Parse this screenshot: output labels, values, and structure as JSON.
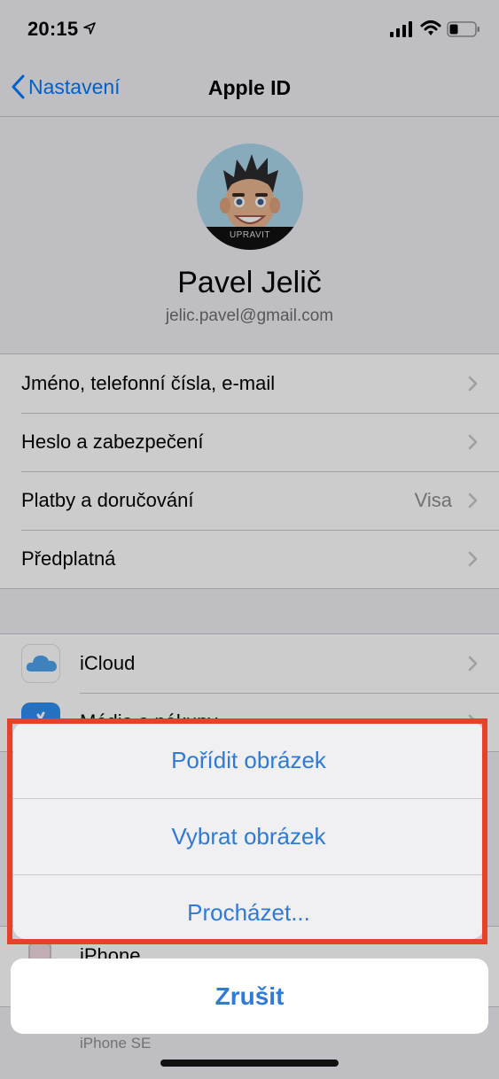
{
  "status_bar": {
    "time": "20:15"
  },
  "nav": {
    "back_label": "Nastavení",
    "title": "Apple ID"
  },
  "profile": {
    "edit_label": "UPRAVIT",
    "name": "Pavel Jelič",
    "email": "jelic.pavel@gmail.com"
  },
  "account_rows": [
    {
      "label": "Jméno, telefonní čísla, e-mail"
    },
    {
      "label": "Heslo a zabezpečení"
    },
    {
      "label": "Platby a doručování",
      "value": "Visa"
    },
    {
      "label": "Předplatná"
    }
  ],
  "service_rows": [
    {
      "label": "iCloud",
      "icon": "icloud-icon"
    },
    {
      "label": "Média a nákupy",
      "icon": "app-store-icon"
    }
  ],
  "device_rows": [
    {
      "label": "iPhone",
      "sublabel": "iPhone SE"
    }
  ],
  "action_sheet": {
    "actions": [
      "Pořídit obrázek",
      "Vybrat obrázek",
      "Procházet..."
    ],
    "cancel": "Zrušit"
  },
  "colors": {
    "accent": "#2e7ad6",
    "highlight": "#e8412a"
  }
}
